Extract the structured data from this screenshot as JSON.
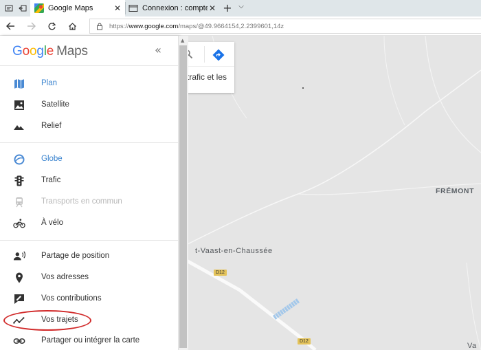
{
  "browser": {
    "tabs": [
      {
        "title": "Google Maps",
        "active": true
      },
      {
        "title": "Connexion : comptes Goog",
        "active": false
      }
    ],
    "address": {
      "prefix": "https://",
      "host": "www.google.com",
      "path": "/maps/@49.9664154,2.2399601,14z"
    }
  },
  "menu": {
    "logo_google": "Google",
    "logo_maps": "Maps",
    "groups": [
      [
        {
          "label": "Plan",
          "icon": "map-icon",
          "state": "selected"
        },
        {
          "label": "Satellite",
          "icon": "satellite-icon",
          "state": "normal"
        },
        {
          "label": "Relief",
          "icon": "terrain-icon",
          "state": "normal"
        }
      ],
      [
        {
          "label": "Globe",
          "icon": "globe-icon",
          "state": "selected"
        },
        {
          "label": "Trafic",
          "icon": "traffic-icon",
          "state": "normal"
        },
        {
          "label": "Transports en commun",
          "icon": "transit-icon",
          "state": "disabled"
        },
        {
          "label": "À vélo",
          "icon": "bike-icon",
          "state": "normal"
        }
      ],
      [
        {
          "label": "Partage de position",
          "icon": "location-sharing-icon",
          "state": "normal"
        },
        {
          "label": "Vos adresses",
          "icon": "place-pin-icon",
          "state": "normal"
        },
        {
          "label": "Vos contributions",
          "icon": "contributions-icon",
          "state": "normal"
        },
        {
          "label": "Vos trajets",
          "icon": "timeline-icon",
          "state": "normal"
        },
        {
          "label": "Partager ou intégrer la carte",
          "icon": "link-icon",
          "state": "normal"
        }
      ]
    ]
  },
  "map": {
    "search_fragment": "trafic et les",
    "labels": {
      "town": "FRÉMONT",
      "village": "t-Vaast-en-Chaussée",
      "edge": "Va"
    },
    "roads": [
      "D12",
      "D12"
    ]
  },
  "colors": {
    "accent": "#3b84cf",
    "highlight_ring": "#d12a2a",
    "map_bg": "#e5e5e5",
    "road_badge": "#e4c35a"
  }
}
